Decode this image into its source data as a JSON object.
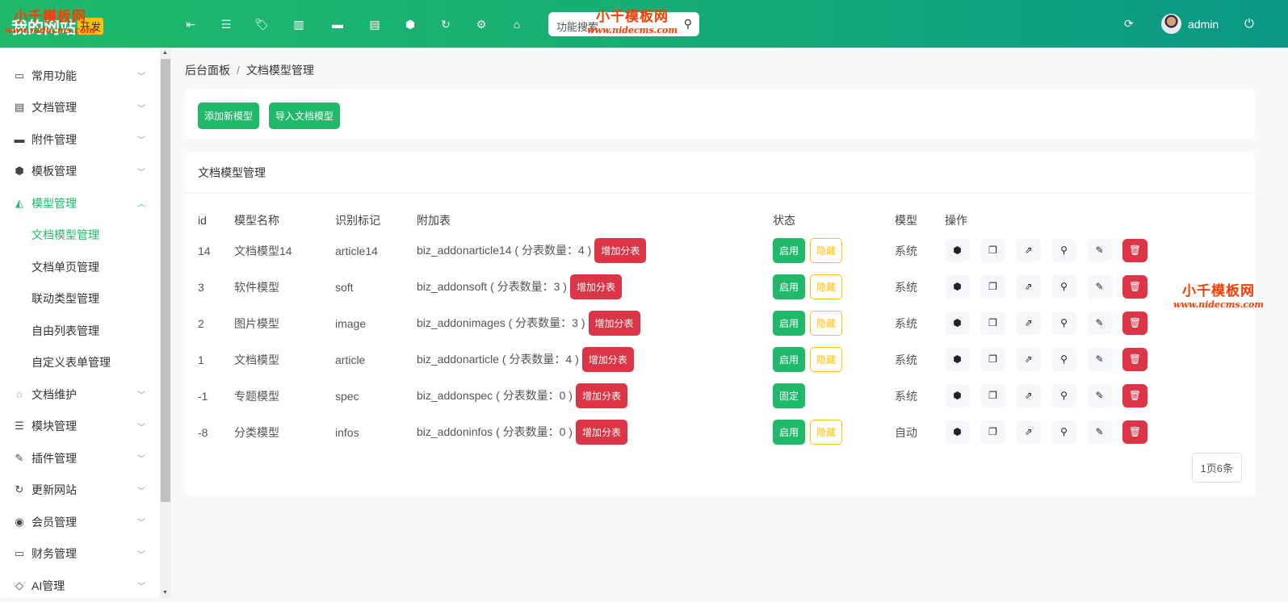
{
  "header": {
    "logo": "我的网站",
    "badge": "开发",
    "search_placeholder": "功能搜索",
    "user": "admin",
    "tools": [
      {
        "icon": "indent-icon",
        "glyph": "⇤"
      },
      {
        "icon": "list-icon",
        "glyph": "☰"
      },
      {
        "icon": "tags-icon",
        "glyph": "🏷"
      },
      {
        "icon": "bar-chart-icon",
        "glyph": "▥"
      },
      {
        "icon": "folder-icon",
        "glyph": "▬"
      },
      {
        "icon": "newspaper-icon",
        "glyph": "▤"
      },
      {
        "icon": "cube-icon",
        "glyph": "⬢"
      },
      {
        "icon": "refresh-icon",
        "glyph": "↻"
      },
      {
        "icon": "gear-icon",
        "glyph": "⚙"
      },
      {
        "icon": "home-icon",
        "glyph": "⌂"
      }
    ]
  },
  "sidebar": {
    "items": [
      {
        "label": "常用功能",
        "glyph": "▭"
      },
      {
        "label": "文档管理",
        "glyph": "▤"
      },
      {
        "label": "附件管理",
        "glyph": "▬"
      },
      {
        "label": "模板管理",
        "glyph": "⬢"
      },
      {
        "label": "模型管理",
        "glyph": "◭"
      }
    ],
    "subitems": [
      "文档模型管理",
      "文档单页管理",
      "联动类型管理",
      "自由列表管理",
      "自定义表单管理"
    ],
    "items2": [
      {
        "label": "文档维护",
        "glyph": "◌"
      },
      {
        "label": "模块管理",
        "glyph": "☰"
      },
      {
        "label": "插件管理",
        "glyph": "✎"
      },
      {
        "label": "更新网站",
        "glyph": "↻"
      },
      {
        "label": "会员管理",
        "glyph": "◉"
      },
      {
        "label": "财务管理",
        "glyph": "▭"
      },
      {
        "label": "AI管理",
        "glyph": "◇"
      }
    ]
  },
  "breadcrumb": {
    "home": "后台面板",
    "current": "文档模型管理"
  },
  "toolbar": {
    "add": "添加新模型",
    "import": "导入文档模型"
  },
  "list": {
    "title": "文档模型管理",
    "columns": [
      "id",
      "模型名称",
      "识别标记",
      "附加表",
      "状态",
      "模型",
      "操作"
    ],
    "add_sub_label": "增加分表",
    "enable_label": "启用",
    "hide_label": "隐藏",
    "fixed_label": "固定",
    "rows": [
      {
        "id": "14",
        "name": "文档模型14",
        "mark": "article14",
        "table": "biz_addonarticle14 ( 分表数量：4 )",
        "status": "启用",
        "hide": true,
        "type": "系统"
      },
      {
        "id": "3",
        "name": "软件模型",
        "mark": "soft",
        "table": "biz_addonsoft ( 分表数量：3 )",
        "status": "启用",
        "hide": true,
        "type": "系统"
      },
      {
        "id": "2",
        "name": "图片模型",
        "mark": "image",
        "table": "biz_addonimages ( 分表数量：3 )",
        "status": "启用",
        "hide": true,
        "type": "系统"
      },
      {
        "id": "1",
        "name": "文档模型",
        "mark": "article",
        "table": "biz_addonarticle ( 分表数量：4 )",
        "status": "启用",
        "hide": true,
        "type": "系统"
      },
      {
        "id": "-1",
        "name": "专题模型",
        "mark": "spec",
        "table": "biz_addonspec ( 分表数量：0 )",
        "status": "固定",
        "hide": false,
        "type": "系统"
      },
      {
        "id": "-8",
        "name": "分类模型",
        "mark": "infos",
        "table": "biz_addoninfos ( 分表数量：0 )",
        "status": "启用",
        "hide": true,
        "type": "自动"
      }
    ],
    "pager": "1页6条"
  },
  "watermark": {
    "title": "小千模板网",
    "url": "www.nidecms.com"
  }
}
